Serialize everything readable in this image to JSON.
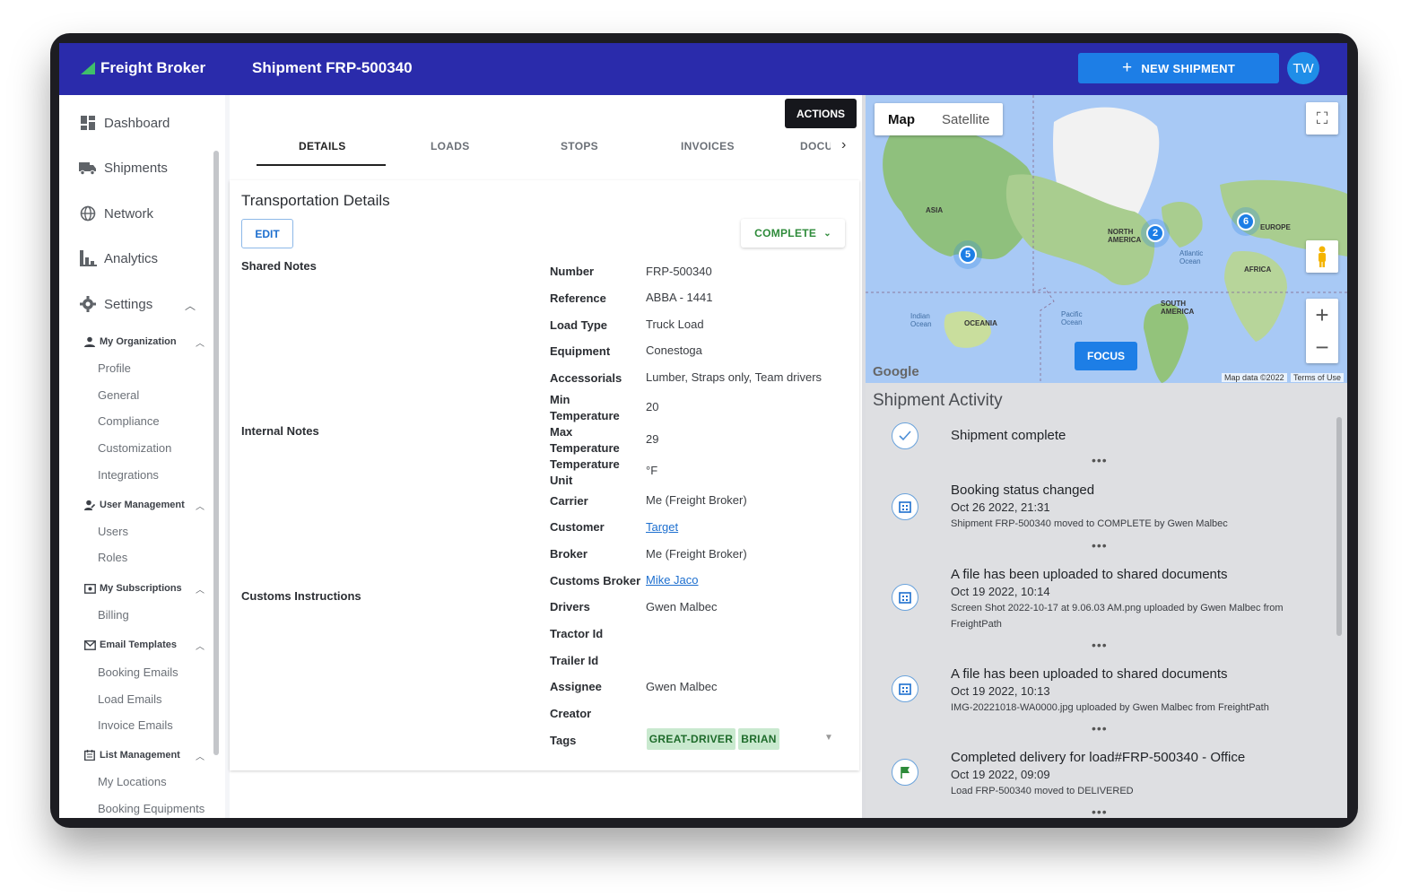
{
  "header": {
    "brand": "Freight Broker",
    "title": "Shipment FRP-500340",
    "new_shipment": "NEW SHIPMENT",
    "avatar_initials": "TW"
  },
  "colors": {
    "topbar": "#2a2bab",
    "primary": "#1d7ee6",
    "complete": "#2e8b3a",
    "tag_bg": "#c9e9cf"
  },
  "sidebar": {
    "items": [
      {
        "label": "Dashboard",
        "icon": "dashboard-icon"
      },
      {
        "label": "Shipments",
        "icon": "truck-icon"
      },
      {
        "label": "Network",
        "icon": "globe-icon"
      },
      {
        "label": "Analytics",
        "icon": "bar-chart-icon"
      },
      {
        "label": "Settings",
        "icon": "gear-icon"
      }
    ],
    "groups": [
      {
        "label": "My Organization",
        "children": [
          "Profile",
          "General",
          "Compliance",
          "Customization",
          "Integrations"
        ]
      },
      {
        "label": "User Management",
        "children": [
          "Users",
          "Roles"
        ]
      },
      {
        "label": "My Subscriptions",
        "children": [
          "Billing"
        ]
      },
      {
        "label": "Email Templates",
        "children": [
          "Booking Emails",
          "Load Emails",
          "Invoice Emails"
        ]
      },
      {
        "label": "List Management",
        "children": [
          "My Locations",
          "Booking Equipments"
        ]
      }
    ]
  },
  "main": {
    "actions": "ACTIONS",
    "tabs": [
      "DETAILS",
      "LOADS",
      "STOPS",
      "INVOICES",
      "DOCU"
    ],
    "card_title": "Transportation Details",
    "edit": "EDIT",
    "status": "COMPLETE",
    "sections": [
      "Shared Notes",
      "Internal Notes",
      "Customs Instructions"
    ],
    "fields": [
      {
        "label": "Number",
        "value": "FRP-500340"
      },
      {
        "label": "Reference",
        "value": "ABBA - 1441"
      },
      {
        "label": "Load Type",
        "value": "Truck Load"
      },
      {
        "label": "Equipment",
        "value": "Conestoga"
      },
      {
        "label": "Accessorials",
        "value": "Lumber, Straps only, Team drivers"
      },
      {
        "label": "Min Temperature",
        "value": "20"
      },
      {
        "label": "Max Temperature",
        "value": "29"
      },
      {
        "label": "Temperature Unit",
        "value": "°F"
      },
      {
        "label": "Carrier",
        "value": "Me (Freight Broker)"
      },
      {
        "label": "Customer",
        "value": "Target"
      },
      {
        "label": "Broker",
        "value": "Me (Freight Broker)"
      },
      {
        "label": "Customs Broker",
        "value": "Mike Jaco"
      },
      {
        "label": "Drivers",
        "value": "Gwen Malbec"
      },
      {
        "label": "Tractor Id",
        "value": ""
      },
      {
        "label": "Trailer Id",
        "value": ""
      },
      {
        "label": "Assignee",
        "value": "Gwen Malbec"
      },
      {
        "label": "Creator",
        "value": ""
      },
      {
        "label": "Tags",
        "value": ""
      }
    ],
    "tags": [
      "GREAT-DRIVER",
      "BRIAN"
    ]
  },
  "map": {
    "toggle": [
      "Map",
      "Satellite"
    ],
    "focus": "FOCUS",
    "google": "Google",
    "map_data": "Map data ©2022",
    "terms": "Terms of Use",
    "clusters": [
      "5",
      "2",
      "6"
    ],
    "labels": [
      "ASIA",
      "NORTH AMERICA",
      "EUROPE",
      "AFRICA",
      "SOUTH AMERICA",
      "OCEANIA",
      "Indian Ocean",
      "Pacific Ocean",
      "Atlantic Ocean"
    ]
  },
  "activity": {
    "title": "Shipment Activity",
    "items": [
      {
        "icon": "check-circle-icon",
        "head": "Shipment complete",
        "date": "",
        "desc": ""
      },
      {
        "icon": "building-icon",
        "head": "Booking status changed",
        "date": "Oct 26 2022, 21:31",
        "desc": "Shipment FRP-500340 moved to COMPLETE by Gwen Malbec"
      },
      {
        "icon": "building-icon",
        "head": "A file has been uploaded to shared documents",
        "date": "Oct 19 2022, 10:14",
        "desc": "Screen Shot 2022-10-17 at 9.06.03 AM.png uploaded by Gwen Malbec from FreightPath"
      },
      {
        "icon": "building-icon",
        "head": "A file has been uploaded to shared documents",
        "date": "Oct 19 2022, 10:13",
        "desc": "IMG-20221018-WA0000.jpg uploaded by Gwen Malbec from FreightPath"
      },
      {
        "icon": "flag-icon",
        "head": "Completed delivery for load#FRP-500340 - Office",
        "date": "Oct 19 2022, 09:09",
        "desc": "Load FRP-500340 moved to DELIVERED"
      }
    ]
  }
}
